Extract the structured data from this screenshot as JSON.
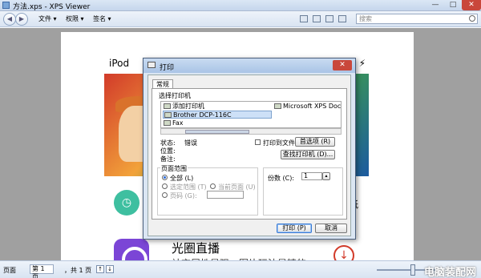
{
  "window": {
    "title": "方法.xps - XPS Viewer",
    "min": "—",
    "max": "□",
    "close": "✕"
  },
  "toolbar": {
    "menus": [
      "文件 ▾",
      "权限 ▾",
      "签名 ▾"
    ],
    "search_placeholder": "搜索",
    "icons": [
      "document-icon",
      "print-icon",
      "fit-page-icon",
      "zoom-icon"
    ]
  },
  "page": {
    "ipod_label": "iPod ",
    "lightning": "⚡",
    "bg_text_right": "纸",
    "app_title": "光圈直播",
    "app_desc": "社交属性是强，图片玩法是精的"
  },
  "status": {
    "page_label": "页面",
    "page_value": "第 1 页",
    "total": "，共 1 页",
    "up_arrow": "↑",
    "down_arrow": "↓",
    "watermark": "电脑装配网"
  },
  "dialog": {
    "title": "打印",
    "close": "✕",
    "tab": "常规",
    "select_printer": "选择打印机",
    "printers": [
      "添加打印机",
      "Brother DCP-116C",
      "Fax",
      "Microsoft XPS Docume"
    ],
    "selected_printer_index": 1,
    "status_label": "状态:",
    "status_value": "错误",
    "location_label": "位置:",
    "comment_label": "备注:",
    "print_to_file": "打印到文件 (F)",
    "preferences": "首选项 (R)",
    "find_printer": "查找打印机 (D)...",
    "page_range": "页面范围",
    "range_all": "全部 (L)",
    "range_selection": "选定范围 (T)",
    "range_current": "当前页面 (U)",
    "range_pages": "页码 (G):",
    "copies_label": "份数 (C):",
    "copies_value": "1",
    "print_button": "打印 (P)",
    "cancel_button": "取消"
  }
}
